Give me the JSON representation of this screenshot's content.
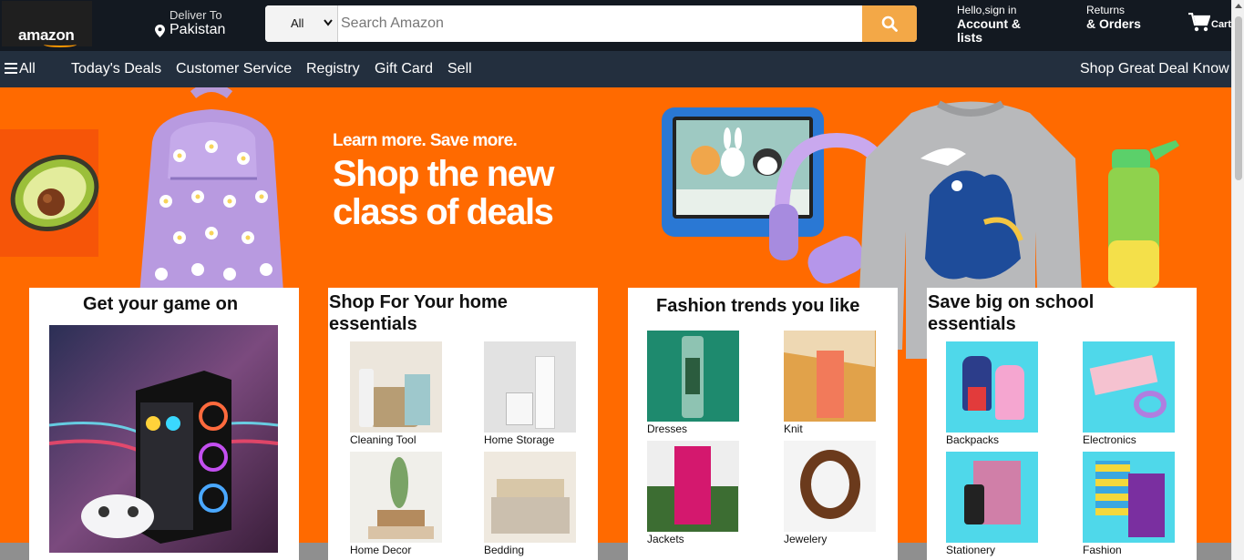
{
  "header": {
    "logo_text": "amazon",
    "deliver_label": "Deliver To",
    "deliver_country": "Pakistan",
    "search": {
      "category": "All",
      "placeholder": "Search Amazon"
    },
    "account_line1": "Hello,sign in",
    "account_line2": "Account & lists",
    "returns_line1": "Returns",
    "returns_line2": "& Orders",
    "cart_label": "Cart"
  },
  "subnav": {
    "all_label": "All",
    "items": [
      "Today's Deals",
      "Customer Service",
      "Registry",
      "Gift Card",
      "Sell"
    ],
    "promo": "Shop Great Deal Know"
  },
  "hero": {
    "small": "Learn more. Save more.",
    "big": "Shop the new class of deals"
  },
  "cards": [
    {
      "title": "Get your game on"
    },
    {
      "title": "Shop For Your home essentials",
      "tiles": [
        "Cleaning Tool",
        "Home Storage",
        "Home Decor",
        "Bedding"
      ]
    },
    {
      "title": "Fashion trends you like",
      "tiles": [
        "Dresses",
        "Knit",
        "Jackets",
        "Jewelery"
      ]
    },
    {
      "title": "Save big on school essentials",
      "tiles": [
        "Backpacks",
        "Electronics",
        "Stationery",
        "Fashion"
      ]
    }
  ],
  "colors": {
    "topbar": "#131921",
    "subnav": "#232f3e",
    "search_button": "#f3a847",
    "hero_bg": "#ff6a00"
  }
}
